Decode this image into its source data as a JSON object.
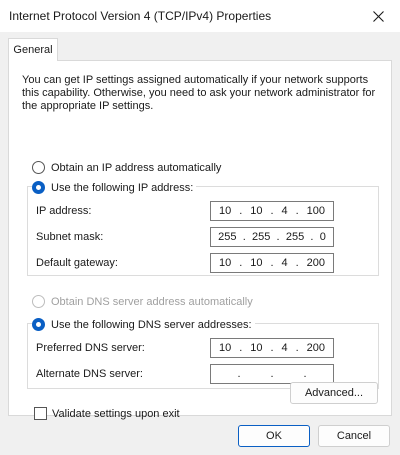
{
  "window": {
    "title": "Internet Protocol Version 4 (TCP/IPv4) Properties",
    "close_icon": "close-icon"
  },
  "tab": {
    "label": "General"
  },
  "description": "You can get IP settings assigned automatically if your network supports this capability. Otherwise, you need to ask your network administrator for the appropriate IP settings.",
  "ip": {
    "auto_label": "Obtain an IP address automatically",
    "manual_label": "Use the following IP address:",
    "selected": "manual",
    "ip_address": {
      "label": "IP address:",
      "octets": [
        "10",
        "10",
        "4",
        "100"
      ]
    },
    "subnet_mask": {
      "label": "Subnet mask:",
      "octets": [
        "255",
        "255",
        "255",
        "0"
      ]
    },
    "default_gateway": {
      "label": "Default gateway:",
      "octets": [
        "10",
        "10",
        "4",
        "200"
      ]
    }
  },
  "dns": {
    "auto_label": "Obtain DNS server address automatically",
    "manual_label": "Use the following DNS server addresses:",
    "selected": "manual",
    "preferred": {
      "label": "Preferred DNS server:",
      "octets": [
        "10",
        "10",
        "4",
        "200"
      ]
    },
    "alternate": {
      "label": "Alternate DNS server:",
      "octets": [
        "",
        "",
        "",
        ""
      ]
    }
  },
  "validate": {
    "label": "Validate settings upon exit",
    "checked": false
  },
  "buttons": {
    "advanced": "Advanced...",
    "ok": "OK",
    "cancel": "Cancel"
  },
  "colors": {
    "accent": "#0a5fc4",
    "background": "#f0f0f0"
  }
}
